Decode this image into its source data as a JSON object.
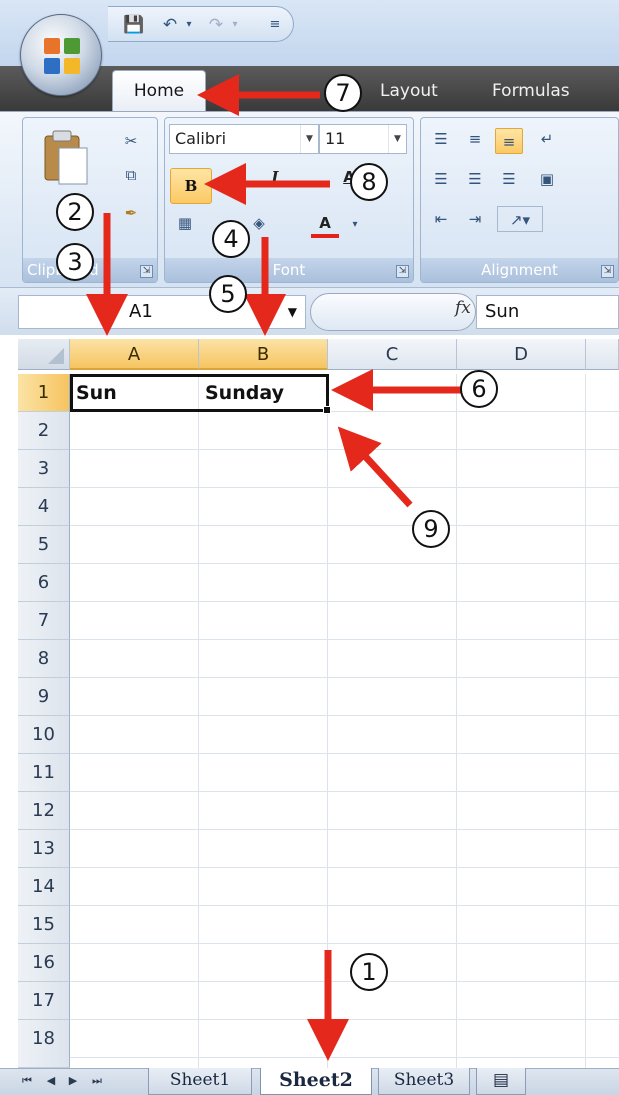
{
  "tabs": {
    "home": "Home",
    "layout": "Layout",
    "formulas": "Formulas"
  },
  "ribbon": {
    "font_name": "Calibri",
    "font_size": "11",
    "bold_label": "B",
    "font_color_label": "A",
    "font_group": "Font",
    "alignment_group": "Alignment",
    "clipboard_group": "Clipboard"
  },
  "formula_bar": {
    "name_box": "A1",
    "fx": "fx",
    "formula": "Sun"
  },
  "grid": {
    "columns": [
      "A",
      "B",
      "C",
      "D"
    ],
    "rows": [
      "1",
      "2",
      "3",
      "4",
      "5",
      "6",
      "7",
      "8",
      "9",
      "10",
      "11",
      "12",
      "13",
      "14",
      "15",
      "16",
      "17",
      "18"
    ],
    "cells": {
      "A1": "Sun",
      "B1": "Sunday"
    }
  },
  "sheets": [
    "Sheet1",
    "Sheet2",
    "Sheet3"
  ],
  "callouts": [
    "1",
    "2",
    "3",
    "4",
    "5",
    "6",
    "7",
    "8",
    "9"
  ],
  "colors": {
    "arrow": "#e4281c",
    "selection_highlight": "#f6c460",
    "ribbon_blue": "#dbe7f5"
  }
}
